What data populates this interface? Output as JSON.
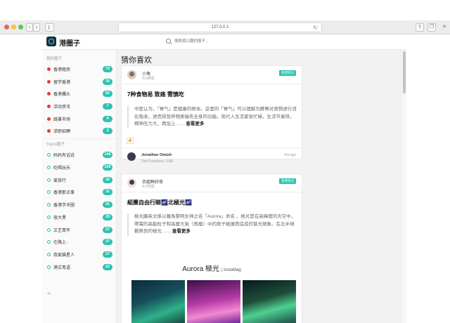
{
  "browser": {
    "url": "127.0.0.1"
  },
  "header": {
    "site_name": "港圈子",
    "search_placeholder": "搜索感兴趣的圈子..."
  },
  "sidebar": {
    "my_section": "我的圈子",
    "my_items": [
      {
        "label": "香港租房",
        "count": "72"
      },
      {
        "label": "留学香港",
        "count": "76"
      },
      {
        "label": "香港攝头",
        "count": "62"
      },
      {
        "label": "活动资讯",
        "count": "7"
      },
      {
        "label": "跳蚤市场",
        "count": "4"
      },
      {
        "label": "求职招聘",
        "count": "3"
      }
    ],
    "top_section": "Top10圈子",
    "top_items": [
      {
        "label": "妈妈有话说",
        "count": "146"
      },
      {
        "label": "吃喝玩乐",
        "count": "105"
      },
      {
        "label": "爱旅行",
        "count": "32"
      },
      {
        "label": "香港那点事",
        "count": "31"
      },
      {
        "label": "香港学术圈",
        "count": "31"
      },
      {
        "label": "夜大黑",
        "count": "29"
      },
      {
        "label": "文艺青年",
        "count": "27"
      },
      {
        "label": "在路上 ·",
        "count": "27"
      },
      {
        "label": "我爱猫星人",
        "count": "27"
      },
      {
        "label": "港式粤语",
        "count": "22"
      }
    ]
  },
  "feed": {
    "title": "猜你喜欢",
    "posts": [
      {
        "author": "小角",
        "time": "5小时前",
        "tag": "香港资讯",
        "title": "7种食物易 致癌 需慎吃",
        "body": "中医认为，「胃气」是健康的根本。这里的「胃气」可以理解为脾胃对食物进行消化吸收，进而将营养物质输布全身的功能。现代人生活紧张忙碌，生活节奏快，精神压力大，再加上 ……",
        "more": "查看更多",
        "comment_name": "Jonathan Omish",
        "comment_location": "San Francisco, USA",
        "comment_time": "5m ago"
      },
      {
        "author": "衣姐鲜好奇",
        "time": "4小时前",
        "tag": "香港资讯",
        "title": "組團自由行睇🌌北極光🌌",
        "body": "極光顯英文係以羅馬黎明女神之名「Aurora」命名 ，極光是在高緯度的天空中，帶電的高能粒子和高層大氣（熱層）中的原子碰撞而造成的發光現象。在北半球觀察到的極光 ……",
        "more": "查看更多",
        "banner_title": "Aurora 極光",
        "banner_brand": "InstaMag"
      }
    ]
  },
  "colors": {
    "accent": "#2dc3b1",
    "dot_red": "#e33b3b"
  }
}
